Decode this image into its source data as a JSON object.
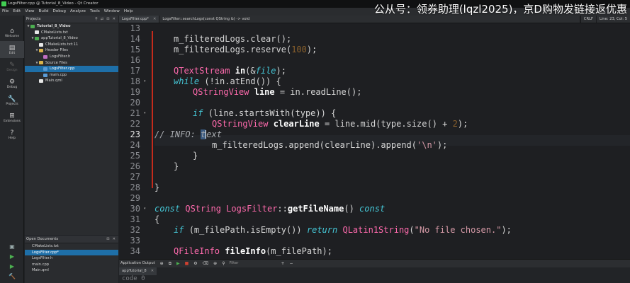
{
  "window": {
    "title": "LogsFilter.cpp @ Tutorial_8_Video - Qt Creator"
  },
  "menu": [
    "File",
    "Edit",
    "View",
    "Build",
    "Debug",
    "Analyze",
    "Tools",
    "Window",
    "Help"
  ],
  "modes": [
    {
      "label": "Welcome",
      "icon": "⌂"
    },
    {
      "label": "Edit",
      "icon": "▤"
    },
    {
      "label": "Design",
      "icon": "✎"
    },
    {
      "label": "Debug",
      "icon": "⚙"
    },
    {
      "label": "Projects",
      "icon": "🔧"
    },
    {
      "label": "Extensions",
      "icon": "⊞"
    },
    {
      "label": "Help",
      "icon": "?"
    }
  ],
  "projects_pane": {
    "title": "Projects",
    "tree": [
      {
        "label": "Tutorial_8_Video"
      },
      {
        "label": "CMakeLists.txt"
      },
      {
        "label": "appTutorial_8_Video"
      },
      {
        "label": "CMakeLists.txt:11"
      },
      {
        "label": "Header Files"
      },
      {
        "label": "LogsFilter.h"
      },
      {
        "label": "Source Files"
      },
      {
        "label": "LogsFilter.cpp"
      },
      {
        "label": "main.cpp"
      },
      {
        "label": "Main.qml"
      }
    ]
  },
  "open_docs": {
    "title": "Open Documents",
    "items": [
      "CMakeLists.txt",
      "LogsFilter.cpp*",
      "LogsFilter.h",
      "main.cpp",
      "Main.qml"
    ]
  },
  "editor": {
    "file_tab": "LogsFilter.cpp*",
    "symbol_tab": "LogsFilter::searchLogs(const QString &) -> void",
    "line_ending": "CRLF",
    "position": "Line: 23, Col: 5",
    "lines": [
      13,
      14,
      15,
      16,
      17,
      18,
      19,
      20,
      21,
      22,
      23,
      24,
      25,
      26,
      27,
      28,
      29,
      30,
      31,
      32,
      33,
      34
    ],
    "current_line": 23,
    "code": {
      "l14_a": "m_filteredLogs",
      "l14_b": ".clear();",
      "l15_a": "m_filteredLogs",
      "l15_b": ".reserve(",
      "l15_num": "100",
      "l15_c": ");",
      "l17_t": "QTextStream",
      "l17_f": "in",
      "l17_p": "(&",
      "l17_k": "file",
      "l17_e": ");",
      "l18_k": "while",
      "l18_p": "(!in.atEnd()) {",
      "l19_t": "QStringView",
      "l19_f": "line",
      "l19_p": "= in.readLine();",
      "l21_k": "if",
      "l21_p": "(line.startsWith(type)) {",
      "l22_t": "QStringView",
      "l22_f": "clearLine",
      "l22_p": "= line.mid(type.size() + ",
      "l22_num": "2",
      "l22_e": ");",
      "l23_cm_a": "// INFO: ",
      "l23_cm_b": "t",
      "l23_cm_c": "ext",
      "l24_a": "m_filteredLogs",
      "l24_b": ".append(clearLine).append(",
      "l24_s": "'\\n'",
      "l24_e": ");",
      "l25": "}",
      "l26": "}",
      "l28": "}",
      "l30_k": "const",
      "l30_t": "QString",
      "l30_c": "LogsFilter",
      "l30_op": "::",
      "l30_f": "getFileName",
      "l30_p": "()",
      "l30_k2": "const",
      "l31": "{",
      "l32_k": "if",
      "l32_p": "(m_filePath.isEmpty())",
      "l32_k2": "return",
      "l32_t": "QLatin1String",
      "l32_p2": "(",
      "l32_s": "\"No file chosen.\"",
      "l32_e": ");",
      "l34_t": "QFileInfo",
      "l34_f": "fileInfo",
      "l34_p": "(m_filePath);"
    }
  },
  "app_output": {
    "title": "Application Output",
    "filter_placeholder": "Filter",
    "tab": "appTutorial_8",
    "text": "code 0"
  },
  "watermark": "公从号：领券助理(lqzl2025)，京D购物发链接返优惠"
}
